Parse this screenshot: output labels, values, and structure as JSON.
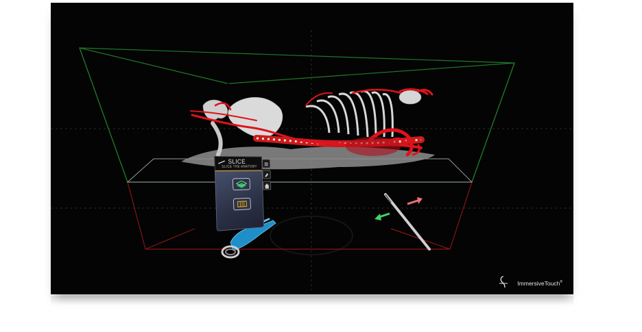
{
  "viewer": {
    "name": "vr-anatomy-viewer",
    "model": "skeleton-with-vasculature"
  },
  "slice_panel": {
    "title": "SLICE",
    "subtitle": "SLICE THE ANATOMY",
    "header_icon": "scalpel-icon",
    "buttons": [
      {
        "icon": "slice-plane-icon"
      },
      {
        "icon": "slice-volume-icon"
      }
    ],
    "side_icons": [
      "menu-icon",
      "eraser-icon",
      "home-icon"
    ]
  },
  "brand": {
    "name": "ImmersiveTouch",
    "mark": "®"
  },
  "colors": {
    "background": "#040404",
    "vessels": "#e0121b",
    "bone": "#d9d9d9",
    "bbox_top": "#1f7a2a",
    "bbox_bottom": "#8a1414",
    "panel_accent": "#e0a51a",
    "hand": "#1e8fc8",
    "arrow_green": "#44d36a",
    "arrow_red": "#f0707a"
  }
}
